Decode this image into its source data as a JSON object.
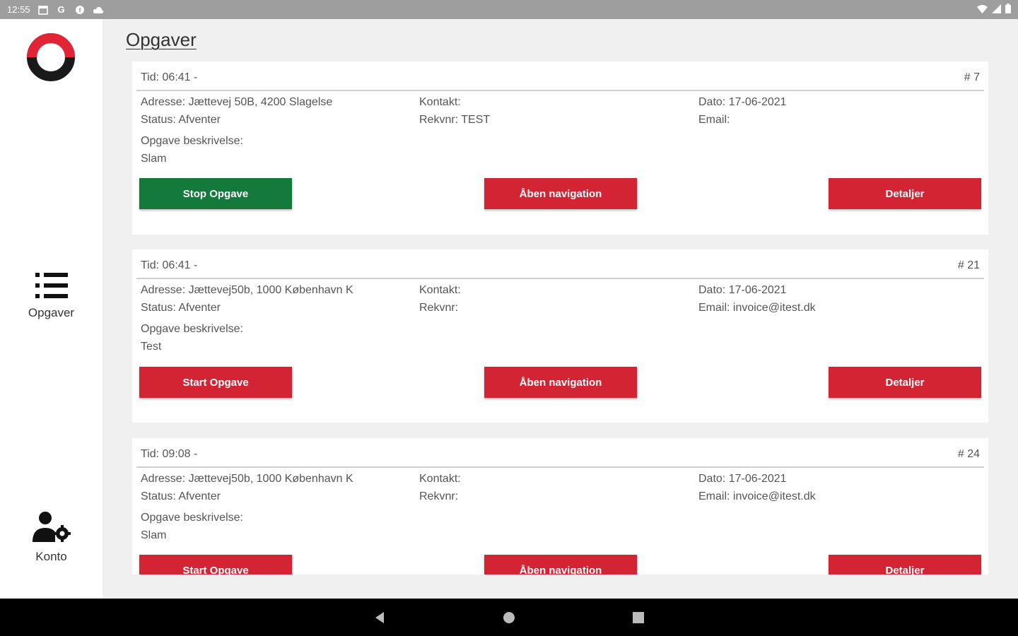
{
  "statusbar": {
    "time": "12:55",
    "icons": [
      "calendar-icon",
      "google-icon",
      "circle-app-icon",
      "cloud-icon"
    ],
    "right_icons": [
      "wifi-icon",
      "signal-icon",
      "battery-icon"
    ]
  },
  "sidebar": {
    "logo": "logo-icon",
    "items": [
      {
        "label": "Opgaver",
        "icon": "list-icon"
      },
      {
        "label": "Konto",
        "icon": "user-settings-icon"
      }
    ]
  },
  "main": {
    "title": "Opgaver",
    "tasks": [
      {
        "time": "Tid: 06:41 -",
        "number": "# 7",
        "address": "Adresse: Jættevej 50B, 4200 Slagelse",
        "status": "Status: Afventer",
        "kontakt": "Kontakt:",
        "rekvnr": "Rekvnr: TEST",
        "dato": "Dato: 17-06-2021",
        "email": "Email:",
        "desc_label": "Opgave beskrivelse:",
        "desc": "Slam",
        "primary_button": "Stop Opgave",
        "nav_button": "Åben navigation",
        "details_button": "Detaljer"
      },
      {
        "time": "Tid: 06:41 -",
        "number": "# 21",
        "address": "Adresse: Jættevej50b, 1000 København K",
        "status": "Status: Afventer",
        "kontakt": "Kontakt:",
        "rekvnr": "Rekvnr:",
        "dato": "Dato: 17-06-2021",
        "email": "Email: invoice@itest.dk",
        "desc_label": "Opgave beskrivelse:",
        "desc": "Test",
        "primary_button": "Start Opgave",
        "nav_button": "Åben navigation",
        "details_button": "Detaljer"
      },
      {
        "time": "Tid: 09:08 -",
        "number": "# 24",
        "address": "Adresse: Jættevej50b, 1000 København K",
        "status": "Status: Afventer",
        "kontakt": "Kontakt:",
        "rekvnr": "Rekvnr:",
        "dato": "Dato: 17-06-2021",
        "email": "Email: invoice@itest.dk",
        "desc_label": "Opgave beskrivelse:",
        "desc": "Slam",
        "primary_button": "Start Opgave",
        "nav_button": "Åben navigation",
        "details_button": "Detaljer"
      }
    ]
  },
  "navbar": {
    "back": "back-icon",
    "home": "home-icon",
    "recents": "recents-icon"
  },
  "colors": {
    "accent_red": "#d32434",
    "accent_green": "#137a3b",
    "logo_red": "#e32436"
  }
}
